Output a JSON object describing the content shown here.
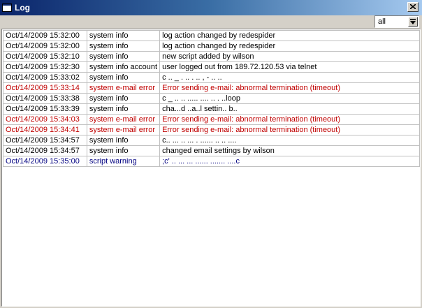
{
  "window": {
    "title": "Log"
  },
  "toolbar": {
    "filter_value": "all"
  },
  "log": {
    "rows": [
      {
        "time": "Oct/14/2009 15:32:00",
        "topic": "system info",
        "message": "log action changed by redespider",
        "level": "info"
      },
      {
        "time": "Oct/14/2009 15:32:00",
        "topic": "system info",
        "message": "log action changed by redespider",
        "level": "info"
      },
      {
        "time": "Oct/14/2009 15:32:10",
        "topic": "system info",
        "message": "new script added by wilson",
        "level": "info"
      },
      {
        "time": "Oct/14/2009 15:32:30",
        "topic": "system info account",
        "message": "user            logged out from 189.72.120.53 via telnet",
        "level": "info"
      },
      {
        "time": "Oct/14/2009 15:33:02",
        "topic": "system info",
        "message": "c  ..  _  .  ..  .  ..  ,   -  ..  ..",
        "level": "info"
      },
      {
        "time": "Oct/14/2009 15:33:14",
        "topic": "system e-mail error",
        "message": "Error sending e-mail: abnormal termination (timeout)",
        "level": "error"
      },
      {
        "time": "Oct/14/2009 15:33:38",
        "topic": "system info",
        "message": "c  _  ..  ..  .....  ....  .. . ..loop",
        "level": "info"
      },
      {
        "time": "Oct/14/2009 15:33:39",
        "topic": "system info",
        "message": "cha...d ..a..l settin.. b..",
        "level": "info"
      },
      {
        "time": "Oct/14/2009 15:34:03",
        "topic": "system e-mail error",
        "message": "Error sending e-mail: abnormal termination (timeout)",
        "level": "error"
      },
      {
        "time": "Oct/14/2009 15:34:41",
        "topic": "system e-mail error",
        "message": "Error sending e-mail: abnormal termination (timeout)",
        "level": "error"
      },
      {
        "time": "Oct/14/2009 15:34:57",
        "topic": "system info",
        "message": "c.. ... .. ...  . ...... .. .. ....",
        "level": "info"
      },
      {
        "time": "Oct/14/2009 15:34:57",
        "topic": "system info",
        "message": "changed email settings by wilson",
        "level": "info"
      },
      {
        "time": "Oct/14/2009 15:35:00",
        "topic": "script warning",
        "message": ";c'   .. ... ... ...... ....... ....c",
        "level": "warning"
      }
    ]
  },
  "colors": {
    "titlebar_start": "#0a246a",
    "titlebar_end": "#a6caf0",
    "error_text": "#c00000",
    "warning_text": "#000080"
  },
  "icons": {
    "title": "window-icon",
    "close": "close-icon",
    "dropdown": "dropdown-arrow-icon"
  }
}
